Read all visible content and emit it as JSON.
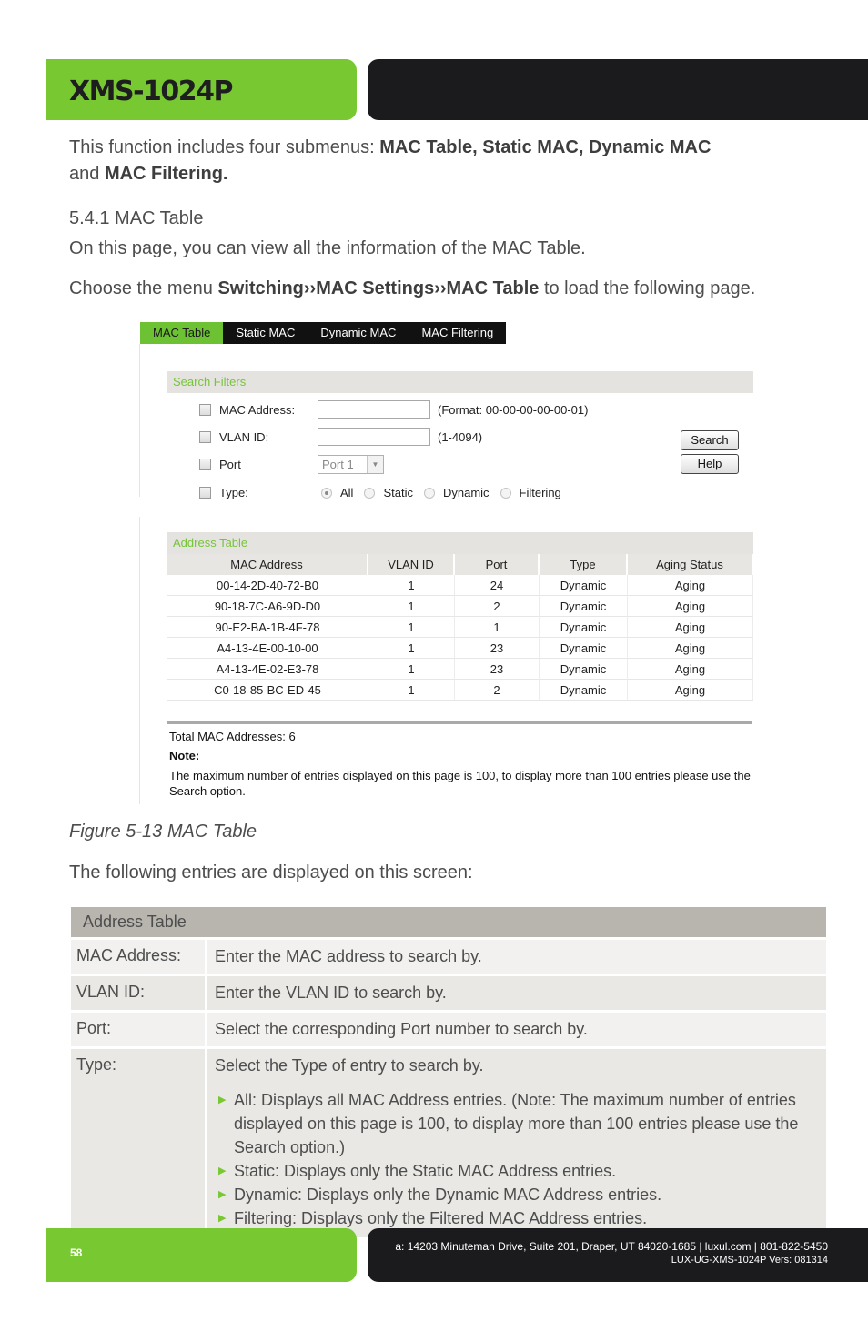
{
  "header": {
    "title": "XMS-1024P"
  },
  "intro": {
    "prefix": "This function includes four submenus: ",
    "bold1": "MAC Table, Static MAC, Dynamic MAC",
    "middle": "and ",
    "bold2": "MAC Filtering."
  },
  "section": {
    "heading": "5.4.1 MAC Table",
    "description": "On this page, you can view all the information of the MAC Table.",
    "choose_prefix": "Choose the menu ",
    "choose_path": "Switching››MAC Settings››MAC Table",
    "choose_suffix": " to load the following page."
  },
  "screenshot": {
    "tabs": [
      {
        "label": "MAC Table",
        "active": true
      },
      {
        "label": "Static MAC",
        "active": false
      },
      {
        "label": "Dynamic MAC",
        "active": false
      },
      {
        "label": "MAC Filtering",
        "active": false
      }
    ],
    "search_filters": {
      "title": "Search Filters",
      "mac_label": "MAC Address:",
      "mac_value": "",
      "mac_hint": "(Format: 00-00-00-00-00-01)",
      "vlan_label": "VLAN ID:",
      "vlan_value": "",
      "vlan_hint": "(1-4094)",
      "port_label": "Port",
      "port_selected": "Port 1",
      "type_label": "Type:",
      "type_options": [
        "All",
        "Static",
        "Dynamic",
        "Filtering"
      ],
      "type_selected": "All",
      "search_button": "Search",
      "help_button": "Help"
    },
    "address_table": {
      "title": "Address Table",
      "columns": [
        "MAC Address",
        "VLAN ID",
        "Port",
        "Type",
        "Aging Status"
      ],
      "rows": [
        [
          "00-14-2D-40-72-B0",
          "1",
          "24",
          "Dynamic",
          "Aging"
        ],
        [
          "90-18-7C-A6-9D-D0",
          "1",
          "2",
          "Dynamic",
          "Aging"
        ],
        [
          "90-E2-BA-1B-4F-78",
          "1",
          "1",
          "Dynamic",
          "Aging"
        ],
        [
          "A4-13-4E-00-10-00",
          "1",
          "23",
          "Dynamic",
          "Aging"
        ],
        [
          "A4-13-4E-02-E3-78",
          "1",
          "23",
          "Dynamic",
          "Aging"
        ],
        [
          "C0-18-85-BC-ED-45",
          "1",
          "2",
          "Dynamic",
          "Aging"
        ]
      ]
    },
    "total": "Total MAC Addresses: 6",
    "note_heading": "Note:",
    "note_text": "The maximum number of entries displayed on this page is 100, to display more than 100 entries please use the Search option."
  },
  "figure_caption": "Figure 5-13 MAC Table",
  "following_text": "The following entries are displayed on this screen:",
  "description_table": {
    "title": "Address Table",
    "rows": [
      {
        "key": "MAC Address:",
        "value": "Enter the MAC address to search by."
      },
      {
        "key": "VLAN ID:",
        "value": "Enter the VLAN ID to search by."
      },
      {
        "key": "Port:",
        "value": "Select the corresponding Port number to search by."
      },
      {
        "key": "Type:",
        "value": "Select the Type of entry to search by.",
        "bullets": [
          "All: Displays all MAC Address entries. (Note: The maximum number of entries displayed on this page is 100, to display more than 100 entries please use the Search option.)",
          "Static: Displays only the Static MAC Address entries.",
          "Dynamic: Displays only the Dynamic MAC Address entries.",
          "Filtering: Displays only the Filtered MAC Address entries."
        ]
      }
    ]
  },
  "footer": {
    "page_number": "58",
    "address": "a: 14203 Minuteman Drive, Suite 201, Draper, UT 84020-1685 | luxul.com | 801-822-5450",
    "version": "LUX-UG-XMS-1024P  Vers: 081314"
  },
  "colors": {
    "brand_green": "#78c832",
    "brand_black": "#1b1a1d",
    "table_header": "#b8b4ae"
  }
}
